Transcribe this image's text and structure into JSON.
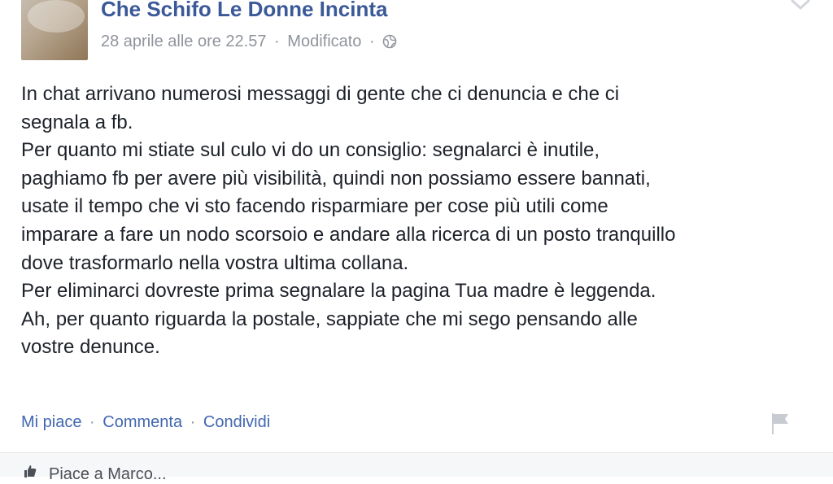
{
  "post": {
    "author": "Che Schifo Le Donne Incinta",
    "date": "28 aprile alle ore 22.57",
    "sep1": "·",
    "edited": "Modificato",
    "sep2": "·",
    "body": [
      "In chat arrivano numerosi messaggi di gente che ci denuncia e che ci",
      "segnala a fb.",
      "Per quanto mi stiate sul culo vi do un consiglio: segnalarci è inutile,",
      "paghiamo fb per avere più visibilità, quindi non possiamo essere bannati,",
      "usate il tempo che vi sto facendo risparmiare per cose più utili come",
      "imparare a fare un nodo scorsoio e andare alla ricerca di un posto tranquillo",
      "dove trasformarlo nella vostra ultima collana.",
      "Per eliminarci dovreste prima segnalare la pagina Tua madre è leggenda.",
      "Ah, per quanto riguarda la postale, sappiate che mi sego pensando alle",
      "vostre denunce."
    ],
    "actions": {
      "like": "Mi piace",
      "comment": "Commenta",
      "share": "Condividi",
      "sep": "·"
    },
    "icons": {
      "privacy": "globe-icon",
      "options": "chevron-down-icon",
      "report": "flag-icon",
      "footer": "thumbs-up-icon"
    },
    "colors": {
      "link": "#3b5998",
      "action_link": "#4267b2",
      "meta": "#90949c",
      "text": "#1d2129"
    }
  },
  "footer": {
    "label": "Piace a Marco..."
  }
}
